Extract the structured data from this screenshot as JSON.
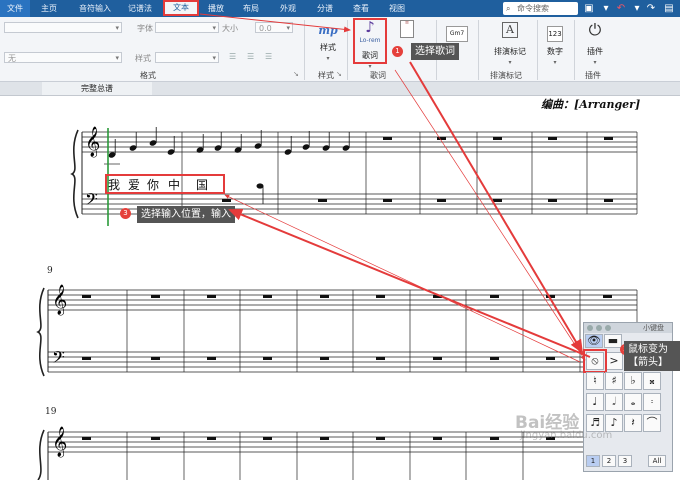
{
  "tabs": [
    "文件",
    "主页",
    "音符输入",
    "记谱法",
    "文本",
    "播放",
    "布局",
    "外观",
    "分谱",
    "查看",
    "视图"
  ],
  "active_tab": "文本",
  "search_placeholder": "命令搜索",
  "ribbon": {
    "font_label": "字体",
    "size_label": "大小",
    "size_value": "0.0",
    "style_label": "样式",
    "none_value": "无",
    "format_group": "格式",
    "styles_button": "样式",
    "styles_group": "样式",
    "lyrics_button": "歌词",
    "lyrics_icon_text": "Lo-rem",
    "lyrics_group": "歌词",
    "engraving_button": "排演标记",
    "engraving_group": "排演标记",
    "chord_icon_text": "Gm7",
    "number_button": "数字",
    "plugin_button": "插件",
    "plugin_group": "插件"
  },
  "view_tab": "完整总谱",
  "score": {
    "arranger": "编曲：[Arranger]",
    "measure_9": "9",
    "measure_19": "19",
    "lyrics": [
      "我",
      "爱",
      "你",
      "中",
      "国"
    ]
  },
  "callouts": {
    "c1_num": "1",
    "c1_text": "选择歌词",
    "c2_num": "2",
    "c2_text_line1": "鼠标变为",
    "c2_text_line2": "【箭头】",
    "c3_num": "3",
    "c3_text": "选择输入位置，输入"
  },
  "keypad": {
    "title": "小键盘",
    "bottom_all": "All",
    "bottom_nums": [
      "1",
      "2",
      "3"
    ]
  },
  "watermark": "Bai经验",
  "watermark_sub": "jingyan.baidu.com"
}
